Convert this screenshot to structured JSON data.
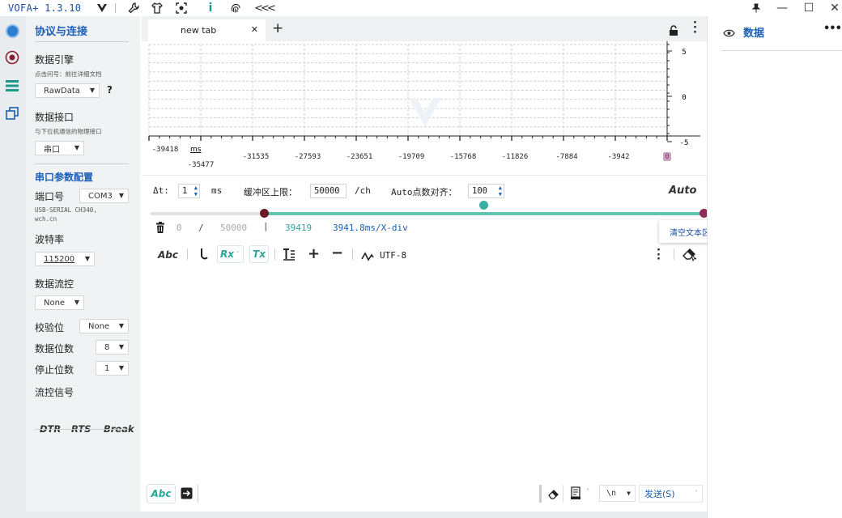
{
  "app": {
    "title": "VOFA+ 1.3.10"
  },
  "window": {
    "pin_icon": "pin-icon",
    "minimize": "—",
    "maximize": "☐",
    "close": "✕"
  },
  "sidebar": {
    "section_protocol": "协议与连接",
    "engine_label": "数据引擎",
    "engine_hint": "点击问号：前往详细文档",
    "engine_value": "RawData",
    "engine_help": "?",
    "interface_label": "数据接口",
    "interface_hint": "与下位机通信的物理接口",
    "interface_value": "串口",
    "section_serial": "串口参数配置",
    "port_label": "端口号",
    "port_value": "COM3",
    "port_desc_1": "USB-SERIAL CH340,",
    "port_desc_2": "wch.cn",
    "baud_label": "波特率",
    "baud_value": "115200",
    "flow_label": "数据流控",
    "flow_value": "None",
    "parity_label": "校验位",
    "parity_value": "None",
    "databits_label": "数据位数",
    "databits_value": "8",
    "stopbits_label": "停止位数",
    "stopbits_value": "1",
    "signals_label": "流控信号",
    "signals": {
      "dtr": "DTR",
      "rts": "RTS",
      "brk": "Break"
    }
  },
  "tabs": {
    "active": "new tab",
    "close": "✕",
    "add": "+"
  },
  "chart": {
    "y_ticks": [
      "5",
      "0",
      "-5"
    ],
    "x_ticks": [
      "-39418",
      "-35477",
      "-31535",
      "-27593",
      "-23651",
      "-19709",
      "-15768",
      "-11826",
      "-7884",
      "-3942",
      "0"
    ],
    "x_unit": "ms"
  },
  "controls": {
    "dt_label": "Δt:",
    "dt_value": "1",
    "dt_unit": "ms",
    "buffer_label": "缓冲区上限：",
    "buffer_value": "50000",
    "buffer_unit": "/ch",
    "align_label": "Auto点数对齐：",
    "align_value": "100",
    "auto": "Auto"
  },
  "stats": {
    "a": "0",
    "sep": "/",
    "b": "50000",
    "bar": "|",
    "count": "39419",
    "xdiv": "3941.8ms/X-div"
  },
  "toolbar": {
    "abc": "Abc",
    "rx": "Rx",
    "tx": "Tx",
    "encoding": "UTF-8",
    "tooltip": "清空文本区"
  },
  "rightpanel": {
    "title": "数据",
    "more": "•••"
  },
  "bottom": {
    "abc": "Abc",
    "newline": "\\n",
    "send": "发送(S)"
  },
  "colors": {
    "accent": "#1a5fb4",
    "slider": "#5ec4b0",
    "dark_knob": "#6b1a2a"
  }
}
